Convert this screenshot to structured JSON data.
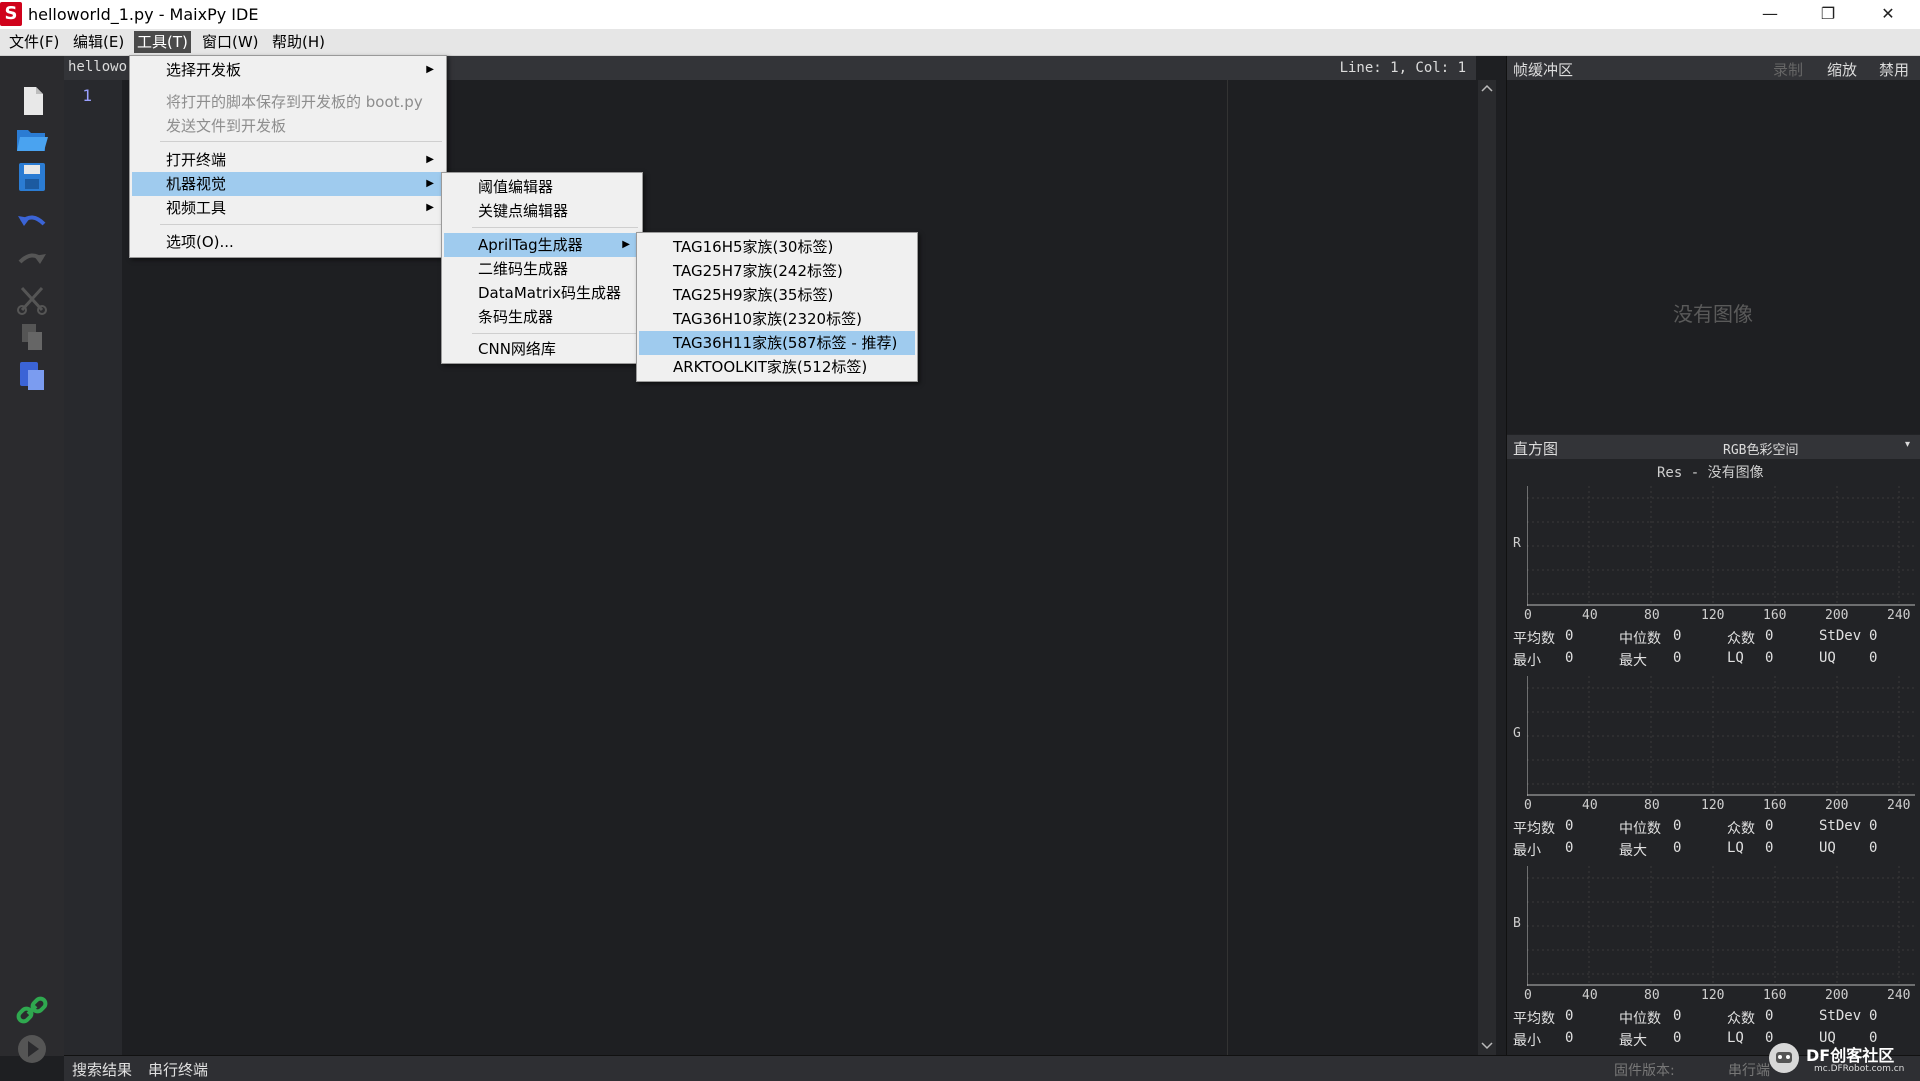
{
  "window": {
    "title": "helloworld_1.py - MaixPy IDE",
    "app_icon_letter": "S",
    "minimize_glyph": "—",
    "restore_glyph": "❐",
    "close_glyph": "✕"
  },
  "menubar": [
    {
      "label": "文件(F)"
    },
    {
      "label": "编辑(E)"
    },
    {
      "label": "工具(T)"
    },
    {
      "label": "窗口(W)"
    },
    {
      "label": "帮助(H)"
    }
  ],
  "editor": {
    "tab_label": "hellowor",
    "cursor_position": "Line: 1, Col: 1",
    "line_number": "1"
  },
  "tools_menu": {
    "items": [
      {
        "label": "选择开发板"
      },
      {
        "label": "将打开的脚本保存到开发板的 boot.py"
      },
      {
        "label": "发送文件到开发板"
      },
      {
        "label": "打开终端"
      },
      {
        "label": "机器视觉"
      },
      {
        "label": "视频工具"
      },
      {
        "label": "选项(O)..."
      }
    ]
  },
  "machine_vision_menu": {
    "items": [
      {
        "label": "阈值编辑器"
      },
      {
        "label": "关键点编辑器"
      },
      {
        "label": "AprilTag生成器"
      },
      {
        "label": "二维码生成器"
      },
      {
        "label": "DataMatrix码生成器"
      },
      {
        "label": "条码生成器"
      },
      {
        "label": "CNN网络库"
      }
    ]
  },
  "apriltag_menu": {
    "items": [
      {
        "label": "TAG16H5家族(30标签)"
      },
      {
        "label": "TAG25H7家族(242标签)"
      },
      {
        "label": "TAG25H9家族(35标签)"
      },
      {
        "label": "TAG36H10家族(2320标签)"
      },
      {
        "label": "TAG36H11家族(587标签 - 推荐)"
      },
      {
        "label": "ARKTOOLKIT家族(512标签)"
      }
    ]
  },
  "frame_buffer": {
    "title": "帧缓冲区",
    "record": "录制",
    "zoom": "缩放",
    "disable": "禁用",
    "no_image": "没有图像"
  },
  "histogram": {
    "title": "直方图",
    "color_space": "RGB色彩空间",
    "res_label": "Res - 没有图像",
    "ticks": [
      "0",
      "40",
      "80",
      "120",
      "160",
      "200",
      "240"
    ],
    "channels": [
      {
        "name": "R",
        "mean_label": "平均数",
        "mean": "0",
        "median_label": "中位数",
        "median": "0",
        "mode_label": "众数",
        "mode": "0",
        "stdev_label": "StDev",
        "stdev": "0",
        "min_label": "最小",
        "min": "0",
        "max_label": "最大",
        "max": "0",
        "lq_label": "LQ",
        "lq": "0",
        "uq_label": "UQ",
        "uq": "0"
      },
      {
        "name": "G",
        "mean_label": "平均数",
        "mean": "0",
        "median_label": "中位数",
        "median": "0",
        "mode_label": "众数",
        "mode": "0",
        "stdev_label": "StDev",
        "stdev": "0",
        "min_label": "最小",
        "min": "0",
        "max_label": "最大",
        "max": "0",
        "lq_label": "LQ",
        "lq": "0",
        "uq_label": "UQ",
        "uq": "0"
      },
      {
        "name": "B",
        "mean_label": "平均数",
        "mean": "0",
        "median_label": "中位数",
        "median": "0",
        "mode_label": "众数",
        "mode": "0",
        "stdev_label": "StDev",
        "stdev": "0",
        "min_label": "最小",
        "min": "0",
        "max_label": "最大",
        "max": "0",
        "lq_label": "LQ",
        "lq": "0",
        "uq_label": "UQ",
        "uq": "0"
      }
    ]
  },
  "bottombar": {
    "search_results": "搜索结果",
    "serial_terminal": "串行终端",
    "firmware_version": "固件版本:",
    "serial_port": "串行端",
    "watermark_brand": "DF创客社区",
    "watermark_url": "mc.DFRobot.com.cn"
  },
  "colors": {
    "highlight": "#9fcbee",
    "editor_bg": "#1e1f22",
    "icon_blue": "#3b82d6",
    "icon_green": "#2fa84f"
  }
}
